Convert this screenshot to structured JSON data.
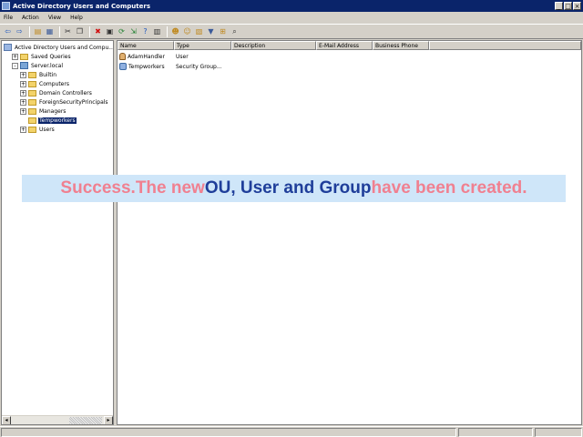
{
  "window": {
    "title": "Active Directory Users and Computers",
    "minimize_glyph": "_",
    "maximize_glyph": "□",
    "close_glyph": "×"
  },
  "menu": [
    {
      "label": "File"
    },
    {
      "label": "Action"
    },
    {
      "label": "View"
    },
    {
      "label": "Help"
    }
  ],
  "toolbar": {
    "buttons": [
      {
        "icon": "back-arrow-icon",
        "glyph": "⇦",
        "color": "#1f58c0"
      },
      {
        "icon": "forward-arrow-icon",
        "glyph": "⇨",
        "color": "#1f58c0"
      },
      {
        "icon": "up-folder-icon",
        "glyph": "▤",
        "color": "#c08a20"
      },
      {
        "icon": "show-hide-tree-icon",
        "glyph": "▦",
        "color": "#3a5a9a"
      },
      {
        "icon": "cut-icon",
        "glyph": "✂",
        "color": "#303030"
      },
      {
        "icon": "copy-icon",
        "glyph": "❐",
        "color": "#303030"
      },
      {
        "icon": "delete-icon",
        "glyph": "✖",
        "color": "#d01010"
      },
      {
        "icon": "properties-icon",
        "glyph": "▣",
        "color": "#303030"
      },
      {
        "icon": "refresh-icon",
        "glyph": "⟳",
        "color": "#208030"
      },
      {
        "icon": "export-list-icon",
        "glyph": "⇲",
        "color": "#208030"
      },
      {
        "icon": "help-icon",
        "glyph": "?",
        "color": "#1f58c0"
      },
      {
        "icon": "console-icon",
        "glyph": "▥",
        "color": "#303030"
      },
      {
        "icon": "new-user-icon",
        "glyph": "☻",
        "color": "#c08a20"
      },
      {
        "icon": "new-group-icon",
        "glyph": "☺",
        "color": "#c08a20"
      },
      {
        "icon": "new-ou-icon",
        "glyph": "▧",
        "color": "#c08a20"
      },
      {
        "icon": "filter-icon",
        "glyph": "▼",
        "color": "#3a5a9a"
      },
      {
        "icon": "add-to-group-icon",
        "glyph": "⊞",
        "color": "#c08a20"
      },
      {
        "icon": "find-icon",
        "glyph": "⌕",
        "color": "#303030"
      }
    ]
  },
  "tree": {
    "items": [
      {
        "label": "Active Directory Users and Compu...",
        "level": 0,
        "expander": "",
        "icon": "root"
      },
      {
        "label": "Saved Queries",
        "level": 1,
        "expander": "+",
        "icon": "folder"
      },
      {
        "label": "Server.local",
        "level": 1,
        "expander": "-",
        "icon": "domain"
      },
      {
        "label": "Builtin",
        "level": 2,
        "expander": "+",
        "icon": "folder"
      },
      {
        "label": "Computers",
        "level": 2,
        "expander": "+",
        "icon": "folder"
      },
      {
        "label": "Domain Controllers",
        "level": 2,
        "expander": "+",
        "icon": "folder"
      },
      {
        "label": "ForeignSecurityPrincipals",
        "level": 2,
        "expander": "+",
        "icon": "folder"
      },
      {
        "label": "Managers",
        "level": 2,
        "expander": "+",
        "icon": "folder"
      },
      {
        "label": "Tempworkers",
        "level": 2,
        "expander": "",
        "icon": "folder",
        "selected": true
      },
      {
        "label": "Users",
        "level": 2,
        "expander": "+",
        "icon": "folder"
      }
    ],
    "scroll_left_glyph": "◂",
    "scroll_right_glyph": "▸"
  },
  "list": {
    "columns": [
      {
        "label": "Name"
      },
      {
        "label": "Type"
      },
      {
        "label": "Description"
      },
      {
        "label": "E-Mail Address"
      },
      {
        "label": "Business Phone"
      }
    ],
    "rows": [
      {
        "name": "AdamHandler",
        "type": "User",
        "icon": "user"
      },
      {
        "name": "Tempworkers",
        "type": "Security Group...",
        "icon": "group"
      }
    ]
  },
  "banner": {
    "part1": "Success.The new ",
    "part2": "OU, User and Group",
    "part3": " have been created."
  },
  "colors": {
    "title_bar": "#0a246a",
    "selection": "#0a246a",
    "banner_background": "#cfe6f9",
    "banner_pink": "#f08090",
    "banner_blue": "#1f3e9a"
  }
}
